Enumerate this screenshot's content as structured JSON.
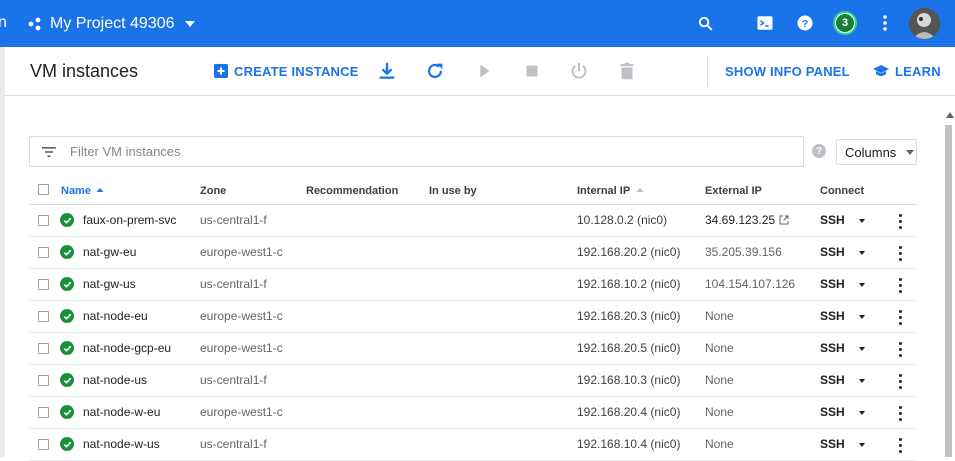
{
  "appbar": {
    "edge_char": "n",
    "project_name": "My Project 49306",
    "notifications_count": "3",
    "colors": {
      "bar": "#1a73e8",
      "badge": "#188038"
    }
  },
  "toolbar": {
    "title": "VM instances",
    "create_instance": "CREATE INSTANCE",
    "show_info_panel": "SHOW INFO PANEL",
    "learn": "LEARN"
  },
  "filter": {
    "placeholder": "Filter VM instances"
  },
  "columns_button": "Columns",
  "help_icon": "?",
  "table": {
    "headers": {
      "name": "Name",
      "zone": "Zone",
      "recommendation": "Recommendation",
      "in_use_by": "In use by",
      "internal_ip": "Internal IP",
      "external_ip": "External IP",
      "connect": "Connect"
    },
    "rows": [
      {
        "name": "faux-on-prem-svc",
        "zone": "us-central1-f",
        "internal_ip": "10.128.0.2",
        "nic": "nic0",
        "external_ip": "34.69.123.25",
        "ssh": "SSH"
      },
      {
        "name": "nat-gw-eu",
        "zone": "europe-west1-c",
        "internal_ip": "192.168.20.2",
        "nic": "nic0",
        "external_ip": "35.205.39.156",
        "ssh": "SSH"
      },
      {
        "name": "nat-gw-us",
        "zone": "us-central1-f",
        "internal_ip": "192.168.10.2",
        "nic": "nic0",
        "external_ip": "104.154.107.126",
        "ssh": "SSH"
      },
      {
        "name": "nat-node-eu",
        "zone": "europe-west1-c",
        "internal_ip": "192.168.20.3",
        "nic": "nic0",
        "external_ip": "None",
        "ssh": "SSH"
      },
      {
        "name": "nat-node-gcp-eu",
        "zone": "europe-west1-c",
        "internal_ip": "192.168.20.5",
        "nic": "nic0",
        "external_ip": "None",
        "ssh": "SSH"
      },
      {
        "name": "nat-node-us",
        "zone": "us-central1-f",
        "internal_ip": "192.168.10.3",
        "nic": "nic0",
        "external_ip": "None",
        "ssh": "SSH"
      },
      {
        "name": "nat-node-w-eu",
        "zone": "europe-west1-c",
        "internal_ip": "192.168.20.4",
        "nic": "nic0",
        "external_ip": "None",
        "ssh": "SSH"
      },
      {
        "name": "nat-node-w-us",
        "zone": "us-central1-f",
        "internal_ip": "192.168.10.4",
        "nic": "nic0",
        "external_ip": "None",
        "ssh": "SSH"
      }
    ]
  }
}
